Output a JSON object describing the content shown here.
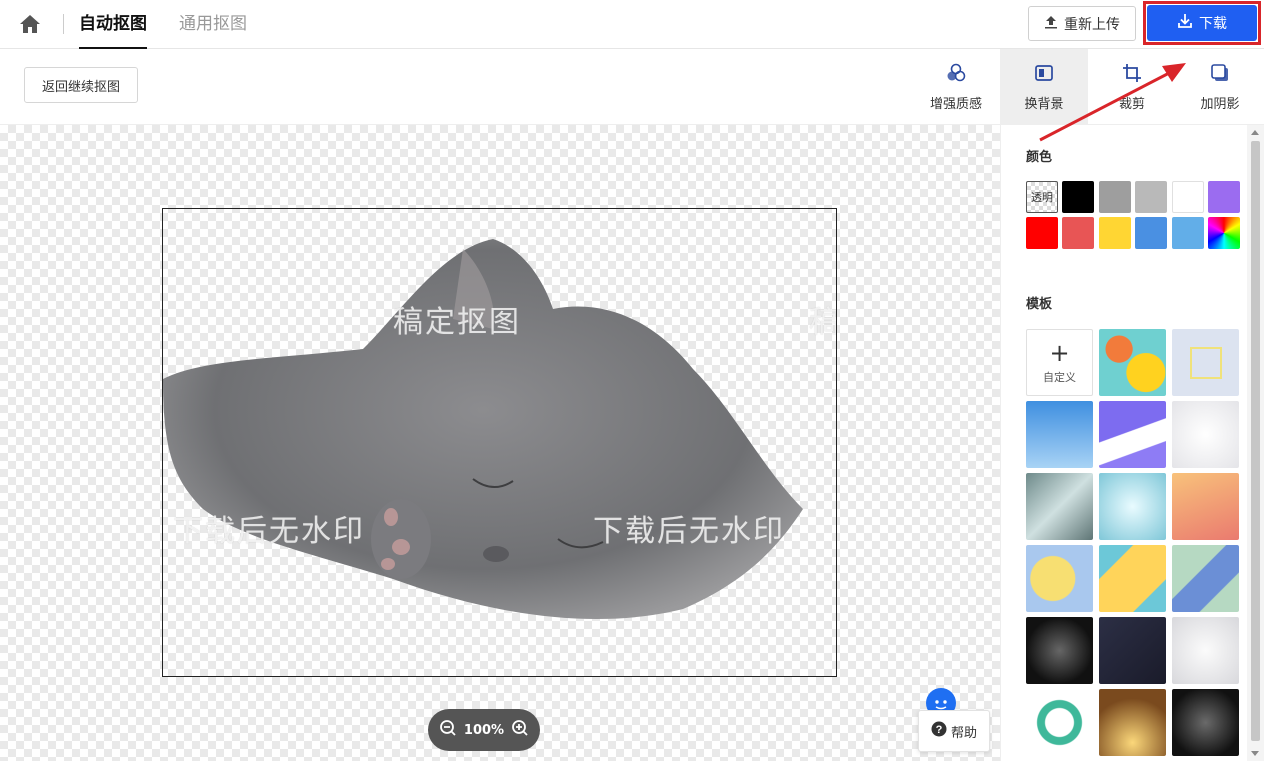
{
  "header": {
    "tabs": [
      {
        "label": "自动抠图",
        "active": true
      },
      {
        "label": "通用抠图",
        "active": false
      }
    ],
    "reupload_label": "重新上传",
    "download_label": "下载"
  },
  "toolbar": {
    "back_label": "返回继续抠图",
    "tools": [
      {
        "label": "增强质感",
        "icon": "enhance-icon"
      },
      {
        "label": "换背景",
        "icon": "background-icon",
        "selected": true
      },
      {
        "label": "裁剪",
        "icon": "crop-icon"
      },
      {
        "label": "加阴影",
        "icon": "shadow-icon"
      }
    ]
  },
  "canvas": {
    "watermarks": [
      "稿定抠图",
      "稿",
      "下载后无水印",
      "下载后无水印"
    ],
    "zoom_level": "100%",
    "help_label": "帮助"
  },
  "panel": {
    "color_title": "颜色",
    "transparent_label": "透明",
    "colors": [
      "transparent",
      "#000000",
      "#9e9e9e",
      "#b9b9b9",
      "#ffffff",
      "#9b6cf0",
      "#ff0000",
      "#e85555",
      "#ffd633",
      "#4a90e2",
      "#62aee8",
      "rainbow"
    ],
    "template_title": "模板",
    "custom_label": "自定义"
  }
}
